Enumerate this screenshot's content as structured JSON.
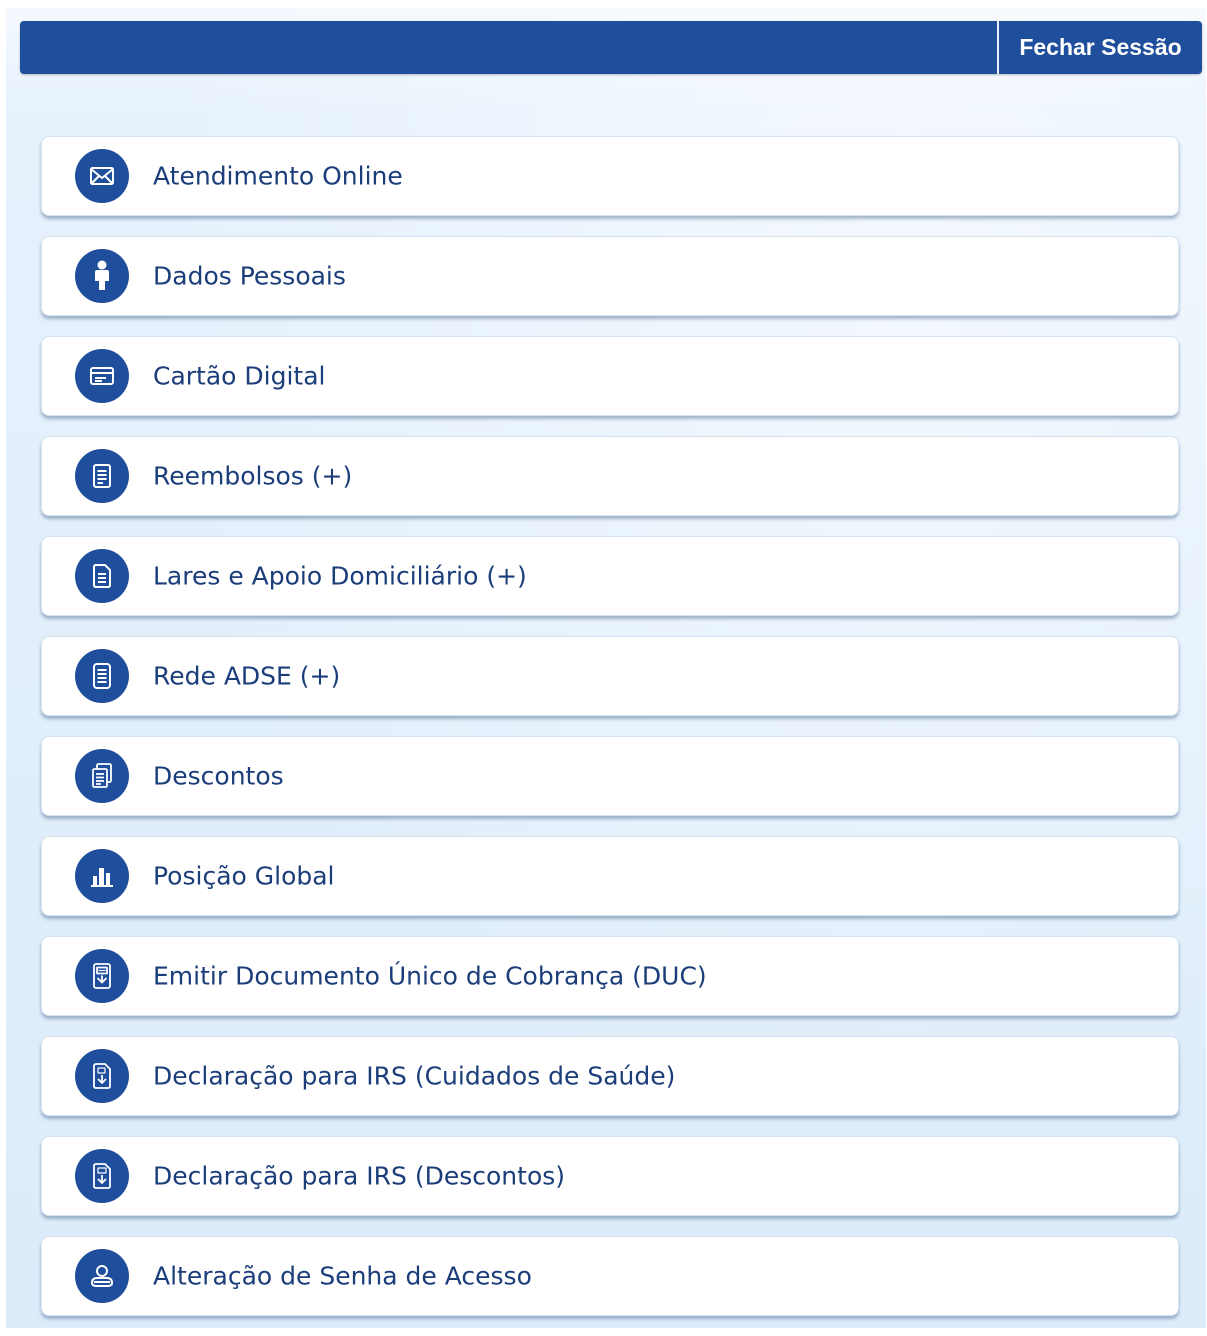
{
  "header": {
    "logout_label": "Fechar Sessão"
  },
  "colors": {
    "primary": "#1f4e9c",
    "text": "#1b3d7a",
    "background": "#dcecfa"
  },
  "menu": {
    "items": [
      {
        "label": "Atendimento Online",
        "icon": "envelope-icon"
      },
      {
        "label": "Dados Pessoais",
        "icon": "person-icon"
      },
      {
        "label": "Cartão Digital",
        "icon": "card-icon"
      },
      {
        "label": "Reembolsos (+)",
        "icon": "document-list-icon"
      },
      {
        "label": "Lares e Apoio Domiciliário (+)",
        "icon": "document-icon"
      },
      {
        "label": "Rede ADSE (+)",
        "icon": "list-icon"
      },
      {
        "label": "Descontos",
        "icon": "documents-stack-icon"
      },
      {
        "label": "Posição Global",
        "icon": "bar-chart-icon"
      },
      {
        "label": "Emitir Documento Único de Cobrança (DUC)",
        "icon": "duc-document-icon"
      },
      {
        "label": "Declaração para IRS (Cuidados de Saúde)",
        "icon": "irs-health-document-icon"
      },
      {
        "label": "Declaração para IRS (Descontos)",
        "icon": "irs-discounts-document-icon"
      },
      {
        "label": "Alteração de Senha de Acesso",
        "icon": "user-password-icon"
      }
    ]
  }
}
